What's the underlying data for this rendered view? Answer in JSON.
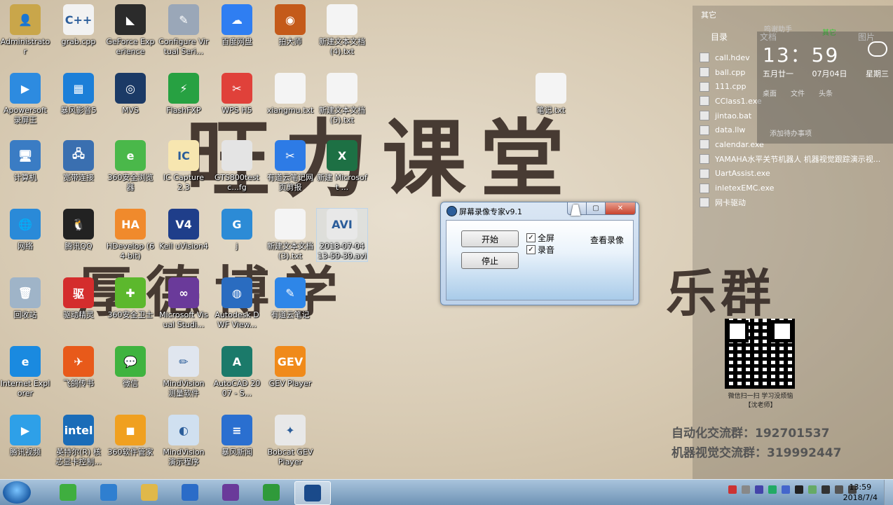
{
  "wallpaper": {
    "line1": "旺力课堂",
    "line2": "厚德博学",
    "line3": "乐群",
    "qr_caption": "微信扫一扫 学习没烦恼",
    "qr_caption2": "【沈老师】",
    "group1": "自动化交流群：192701537",
    "group2": "机器视觉交流群：319992447"
  },
  "desktop_icons": [
    {
      "label": "Administrator",
      "color": "#c9a64a",
      "glyph": "👤"
    },
    {
      "label": "grab.cpp",
      "color": "#f2f2f2",
      "glyph": "C++"
    },
    {
      "label": "GeForce Experience",
      "color": "#2b2b2b",
      "glyph": "◣"
    },
    {
      "label": "Configure Virtual Seri...",
      "color": "#9aa7b8",
      "glyph": "✎"
    },
    {
      "label": "百度网盘",
      "color": "#2f7ef2",
      "glyph": "☁"
    },
    {
      "label": "拍大师",
      "color": "#c45a1a",
      "glyph": "◉"
    },
    {
      "label": "新建文本文档 (4).txt",
      "color": "#f4f4f4",
      "glyph": ""
    },
    {
      "label": "Apowersoft 录屏王",
      "color": "#2d8be0",
      "glyph": "▶"
    },
    {
      "label": "暴风影音5",
      "color": "#1c7fd8",
      "glyph": "▦"
    },
    {
      "label": "MVS",
      "color": "#1b3a66",
      "glyph": "◎"
    },
    {
      "label": "FlashFXP",
      "color": "#27a142",
      "glyph": "⚡"
    },
    {
      "label": "WPS H5",
      "color": "#e0413a",
      "glyph": "✂"
    },
    {
      "label": "xiangmu.txt",
      "color": "#f4f4f4",
      "glyph": ""
    },
    {
      "label": "新建文本文档 (5).txt",
      "color": "#f4f4f4",
      "glyph": ""
    },
    {
      "label": "笔记.txt",
      "color": "#f4f4f4",
      "glyph": ""
    },
    {
      "label": "计算机",
      "color": "#3a7cc4",
      "glyph": "🖥"
    },
    {
      "label": "宽带连接",
      "color": "#3a6fb0",
      "glyph": "🖧"
    },
    {
      "label": "360安全浏览器",
      "color": "#4ab84a",
      "glyph": "e"
    },
    {
      "label": "IC Capture 2.3",
      "color": "#f7e6b0",
      "glyph": "IC"
    },
    {
      "label": "GTS800testc...fg",
      "color": "#e4e4e4",
      "glyph": ""
    },
    {
      "label": "有道云笔记网页剪报",
      "color": "#2d7be6",
      "glyph": "✂"
    },
    {
      "label": "新建 Microsoft ...",
      "color": "#1d7044",
      "glyph": "X"
    },
    {
      "label": "网络",
      "color": "#2a8ad8",
      "glyph": "🌐"
    },
    {
      "label": "腾讯QQ",
      "color": "#222222",
      "glyph": "🐧"
    },
    {
      "label": "HDevelop (64-bit)",
      "color": "#f08a2c",
      "glyph": "HA"
    },
    {
      "label": "Keil uVision4",
      "color": "#1f3e8a",
      "glyph": "V4"
    },
    {
      "label": "j",
      "color": "#2c8bd6",
      "glyph": "G"
    },
    {
      "label": "新建文本文档 (3).txt",
      "color": "#f4f4f4",
      "glyph": ""
    },
    {
      "label": "2018-07-04 13-59-39.avi",
      "color": "#e8e8e8",
      "glyph": "AVI"
    },
    {
      "label": "回收站",
      "color": "#9fb4c8",
      "glyph": "🗑"
    },
    {
      "label": "驱动精灵",
      "color": "#d42d2d",
      "glyph": "驱"
    },
    {
      "label": "360安全卫士",
      "color": "#5cb82d",
      "glyph": "✚"
    },
    {
      "label": "Microsoft Visual Studi...",
      "color": "#6a3a9a",
      "glyph": "∞"
    },
    {
      "label": "Autodesk DWF View...",
      "color": "#2a6cc0",
      "glyph": "◍"
    },
    {
      "label": "有道云笔记",
      "color": "#2e86e8",
      "glyph": "✎"
    },
    {
      "label": "Internet Explorer",
      "color": "#1a8ae0",
      "glyph": "e"
    },
    {
      "label": "飞鸽传书",
      "color": "#e85a1a",
      "glyph": "✈"
    },
    {
      "label": "微信",
      "color": "#3fb33f",
      "glyph": "💬"
    },
    {
      "label": "MindVision 测量软件",
      "color": "#e0e6ef",
      "glyph": "✏"
    },
    {
      "label": "AutoCAD 2007 - S...",
      "color": "#1b7a6a",
      "glyph": "A"
    },
    {
      "label": "GEV Player",
      "color": "#f08a1a",
      "glyph": "GEV"
    },
    {
      "label": "腾讯视频",
      "color": "#2ea0e8",
      "glyph": "▶"
    },
    {
      "label": "英特尔(R) 核芯显卡控制...",
      "color": "#1a6cb8",
      "glyph": "intel"
    },
    {
      "label": "360软件管家",
      "color": "#f0a020",
      "glyph": "◼"
    },
    {
      "label": "MindVision 演示程序",
      "color": "#d0e0f0",
      "glyph": "◐"
    },
    {
      "label": "暴风新闻",
      "color": "#2a6fd0",
      "glyph": "≡"
    },
    {
      "label": "Bobcat GEV Player",
      "color": "#e8e8e8",
      "glyph": "✦"
    }
  ],
  "side_panel": {
    "title": "其它",
    "tabs": [
      "目录",
      "文档",
      "其它",
      "图片"
    ],
    "files": [
      "call.hdev",
      "ball.cpp",
      "111.cpp",
      "CClass1.exe",
      "jintao.bat",
      "data.llw",
      "calendar.exe",
      "YAMAHA水平关节机器人 机器视觉跟踪演示视...",
      "UartAssist.exe",
      "inletexEMC.exe",
      "网卡驱动"
    ],
    "clock_time": "13：59",
    "clock_lunar": "五月廿一",
    "clock_date": "07月04日",
    "clock_weekday": "星期三",
    "clock_row": [
      "桌面",
      "文件",
      "头条"
    ],
    "todo": "添加待办事项",
    "overlay_text": "鸣谢助手"
  },
  "dialog": {
    "title": "屏幕录像专家v9.1",
    "start_label": "开始",
    "stop_label": "停止",
    "fullscreen_label": "全屏",
    "audio_label": "录音",
    "view_label": "查看录像",
    "fullscreen_checked": true,
    "audio_checked": true,
    "min_glyph": "▁",
    "max_glyph": "▢",
    "close_glyph": "✕"
  },
  "taskbar": {
    "time": "13:59",
    "date": "2018/7/4",
    "apps": [
      {
        "name": "360-browser",
        "color": "#3fae3f"
      },
      {
        "name": "video-capture",
        "color": "#2f7fd0"
      },
      {
        "name": "explorer",
        "color": "#e0b84a"
      },
      {
        "name": "word-doc",
        "color": "#2b6cc8"
      },
      {
        "name": "visual-studio",
        "color": "#6a3a9a"
      },
      {
        "name": "green-app",
        "color": "#2f9a3a"
      },
      {
        "name": "screen-recorder",
        "color": "#1a4a8a"
      }
    ],
    "tray_colors": [
      "#c33",
      "#888",
      "#44a",
      "#2a6",
      "#46c",
      "#222",
      "#6a6",
      "#333",
      "#555",
      "#444"
    ]
  }
}
